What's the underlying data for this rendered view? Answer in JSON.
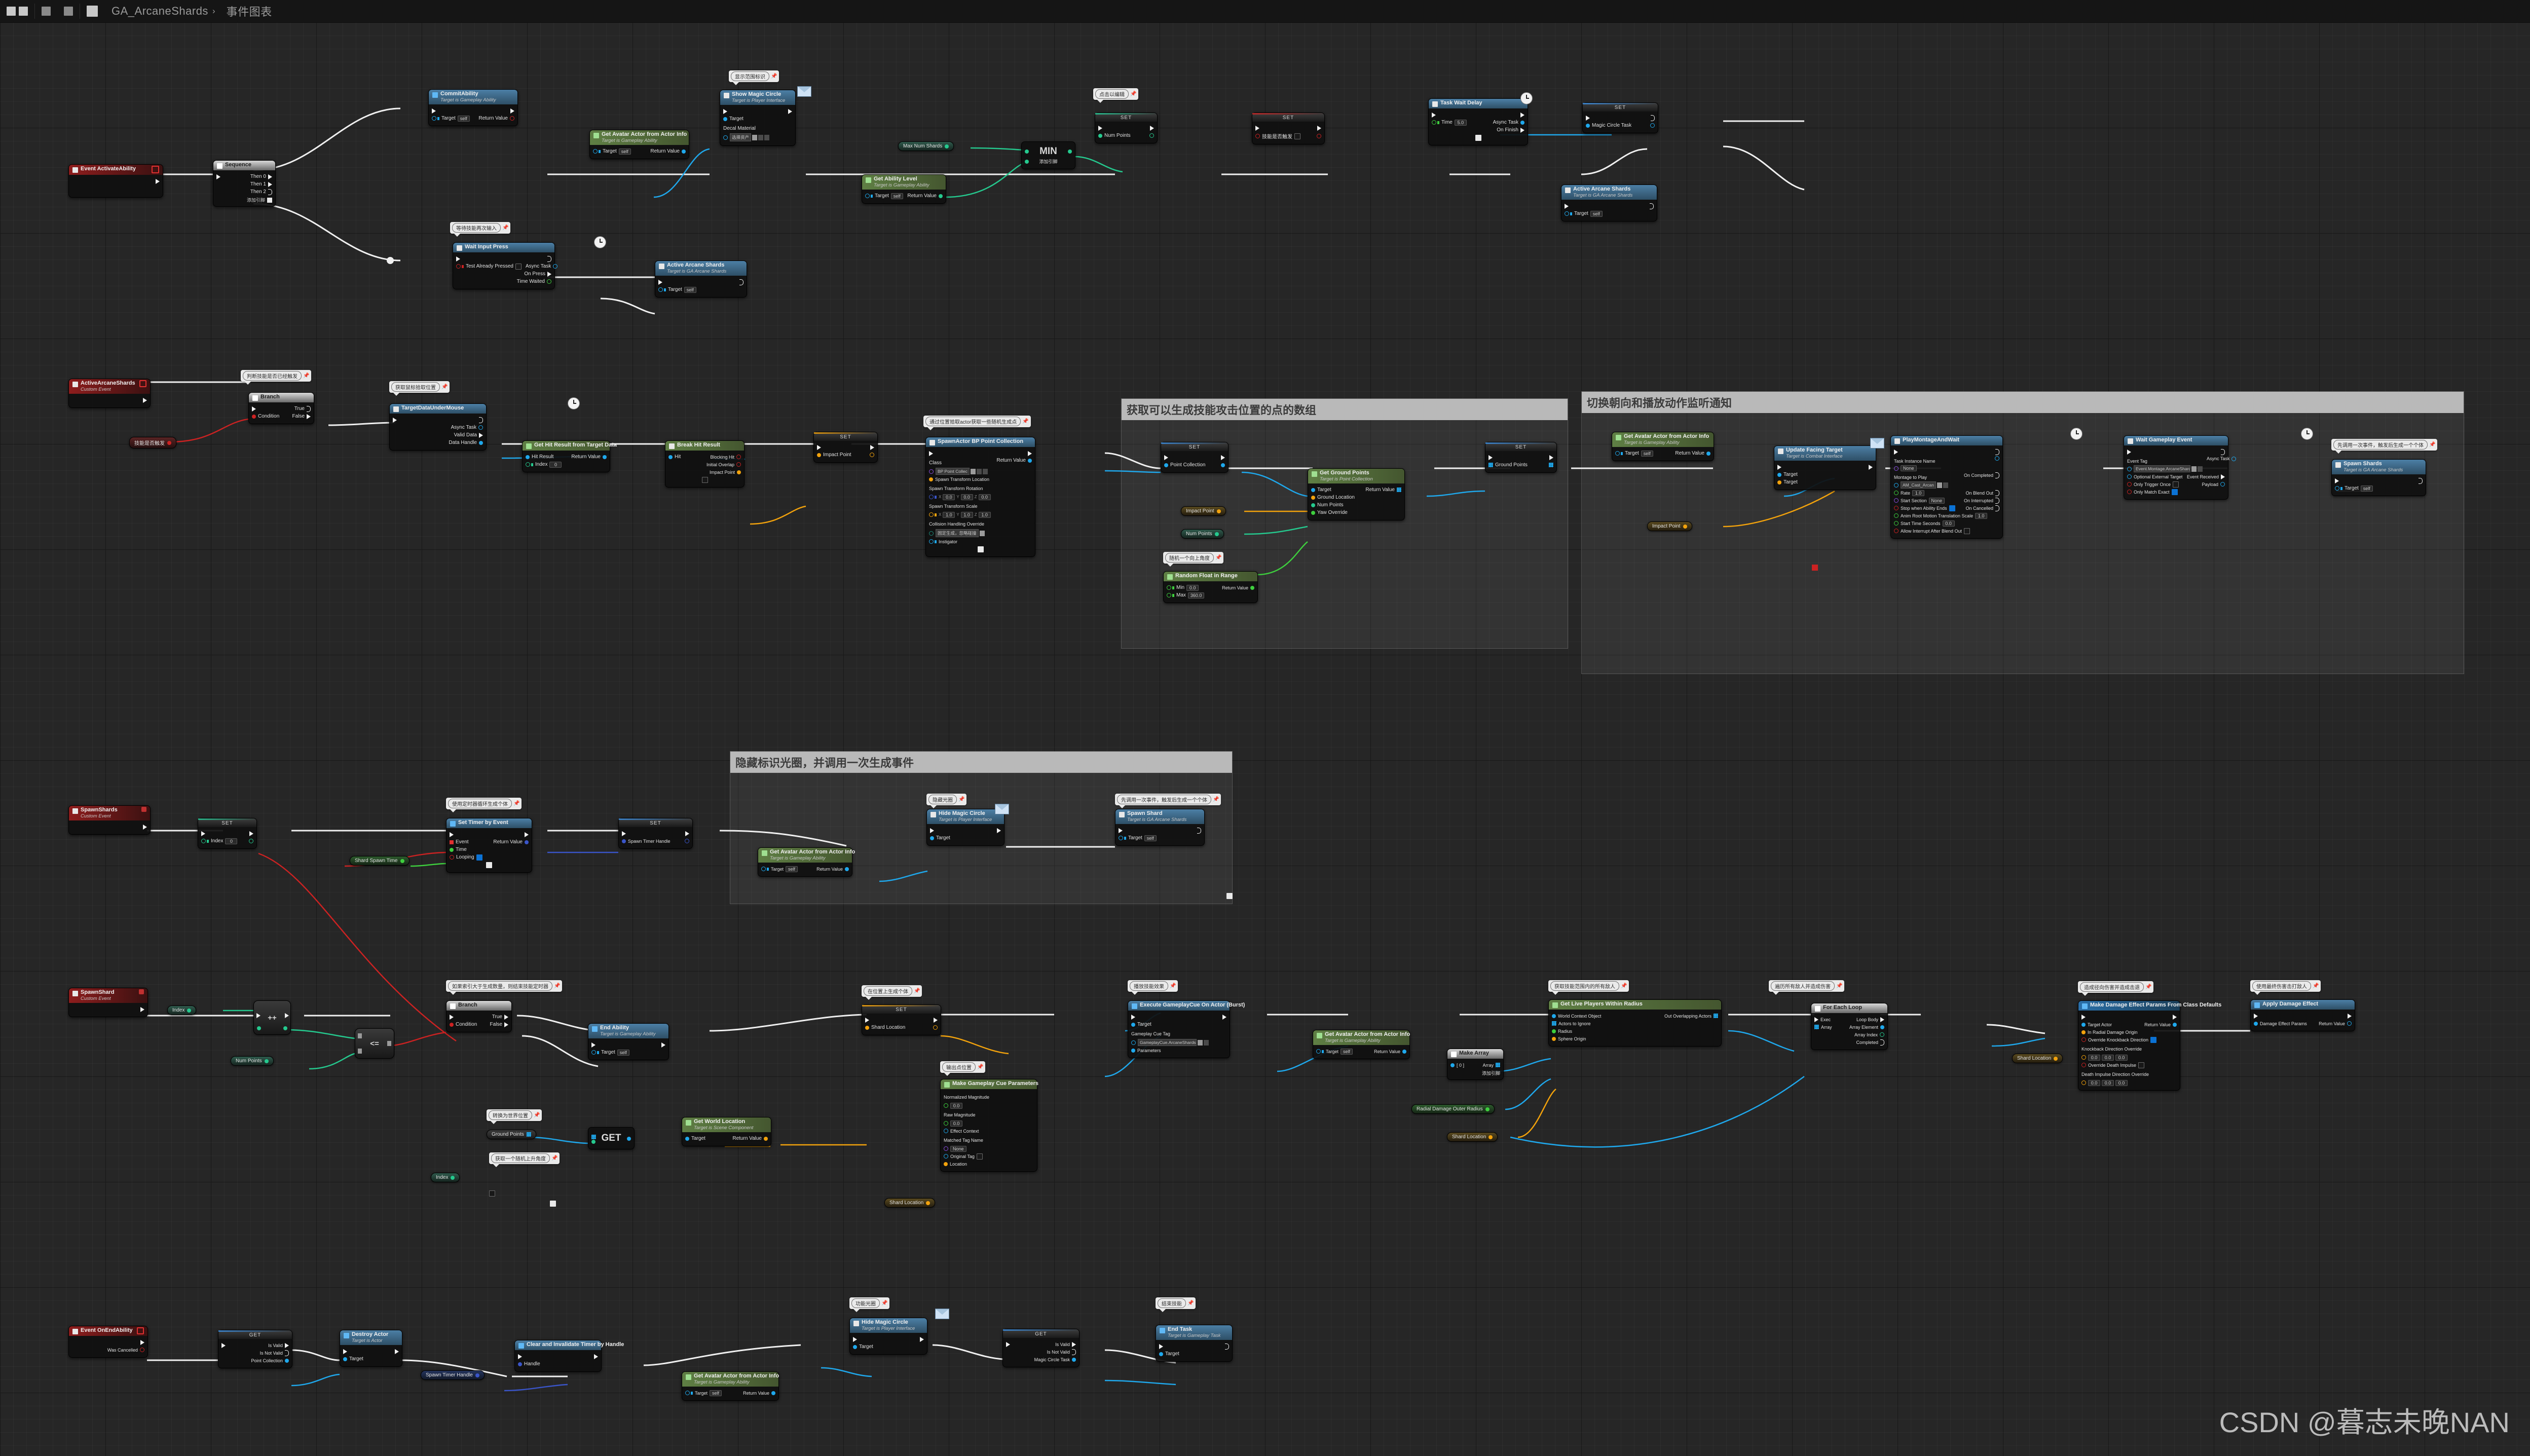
{
  "topbar": {
    "asset_name": "GA_ArcaneShards",
    "chevron": "›",
    "tab_name": "事件图表",
    "right_hint": ""
  },
  "watermark": "CSDN @暮志未晚NAN",
  "labels": {
    "target": "Target",
    "self": "self",
    "return_value": "Return Value",
    "add_pin": "添加引脚",
    "set": "SET",
    "get": "GET",
    "select_asset": "选择资产",
    "none": "None",
    "index": "Index"
  },
  "regions": [
    {
      "title": "获取可以生成技能攻击位置的点的数组"
    },
    {
      "title": "切换朝向和播放动作监听通知"
    },
    {
      "title": "隐藏标识光圈，并调用一次生成事件"
    }
  ],
  "bubbles": [
    {
      "text": "显示范围标识"
    },
    {
      "text": "等待技能再次输入"
    },
    {
      "text": "点击以编辑"
    },
    {
      "text": "判断技能是否已经触发"
    },
    {
      "text": "获取鼠标拾取位置"
    },
    {
      "text": "通过位置拾取actor获取一些随机生成点"
    },
    {
      "text": "随机一个向上角度"
    },
    {
      "text": "使用定时器循环生成个体"
    },
    {
      "text": "隐藏光圈"
    },
    {
      "text": "先调用一次事件，触发后生成一个个体"
    },
    {
      "text": "如果索引大于生成数量，则结束技能定时器"
    },
    {
      "text": "转换为世界位置"
    },
    {
      "text": "在位置上生成个体"
    },
    {
      "text": "获取一个随机上升角度"
    },
    {
      "text": "输出点位置"
    },
    {
      "text": "播放技能效果"
    },
    {
      "text": "获取技能范围内的所有敌人"
    },
    {
      "text": "遍历所有敌人并造成伤害"
    },
    {
      "text": "造成径向伤害并造成击退"
    },
    {
      "text": "使用最终伤害击打敌人"
    },
    {
      "text": "功能光圈"
    },
    {
      "text": "结束技能"
    }
  ],
  "nodes": {
    "event_activate_ability": {
      "title": "Event ActivateAbility"
    },
    "sequence": {
      "title": "Sequence",
      "then0": "Then 0",
      "then1": "Then 1",
      "then2": "Then 2"
    },
    "commit_ability": {
      "title": "CommitAbility",
      "sub": "Target is Gameplay Ability"
    },
    "get_avatar_actor": {
      "title": "Get Avatar Actor from Actor Info",
      "sub": "Target is Gameplay Ability"
    },
    "show_magic_circle": {
      "title": "Show Magic Circle",
      "sub": "Target is Player Interface",
      "decal": "Decal Material"
    },
    "get_ability_level": {
      "title": "Get Ability Level",
      "sub": "Target is Gameplay Ability"
    },
    "max_num_shards": {
      "title": "Max Num Shards"
    },
    "min_node": {
      "title": "MIN"
    },
    "set_num_points": {
      "title": "SET",
      "pin": "Num Points"
    },
    "set_skill_triggered": {
      "title": "SET",
      "pin": "技能是否触发"
    },
    "task_wait_delay": {
      "title": "Task Wait Delay",
      "time_label": "Time",
      "time_value": "5.0",
      "async": "Async Task",
      "on_finish": "On Finish"
    },
    "set_magic_circle_task": {
      "title": "SET",
      "pin": "Magic Circle Task"
    },
    "active_arcane_shards_call": {
      "title": "Active Arcane Shards",
      "sub": "Target is GA Arcane Shards"
    },
    "wait_input_press": {
      "title": "Wait Input Press",
      "test_pressed": "Test Already Pressed",
      "async": "Async Task",
      "on_press": "On Press",
      "time_waited": "Time Waited"
    },
    "event_active_arcane_shards": {
      "title": "ActiveArcaneShards",
      "sub": "Custom Event"
    },
    "var_skill_triggered": {
      "title": "技能是否触发"
    },
    "branch1": {
      "title": "Branch",
      "condition": "Condition",
      "t": "True",
      "f": "False"
    },
    "target_data_under_mouse": {
      "title": "TargetDataUnderMouse",
      "async": "Async Task",
      "valid": "Valid Data",
      "handle": "Data Handle"
    },
    "get_hit_result": {
      "title": "Get Hit Result from Target Data",
      "hit_result": "Hit Result",
      "index_value": "0"
    },
    "break_hit_result": {
      "title": "Break Hit Result",
      "hit": "Hit",
      "blocking": "Blocking Hit",
      "initial_overlap": "Initial Overlap",
      "impact_point": "Impact Point"
    },
    "set_impact_point": {
      "title": "SET",
      "pin": "Impact Point"
    },
    "spawn_actor_bppc": {
      "title": "SpawnActor BP Point Collection",
      "class_label": "Class",
      "class_value": "BP Point Collec",
      "loc_label": "Spawn Transform Location",
      "rot_label": "Spawn Transform Rotation",
      "rot": [
        "0.0",
        "0.0",
        "0.0"
      ],
      "scale_label": "Spawn Transform Scale",
      "scale": [
        "1.0",
        "1.0",
        "1.0"
      ],
      "collision_label": "Collision Handling Override",
      "collision_value": "固定生成，忽略碰撞",
      "instigator": "Instigator"
    },
    "set_point_collection": {
      "title": "SET",
      "pin": "Point Collection"
    },
    "get_ground_points": {
      "title": "Get Ground Points",
      "sub": "Target is Point Collection",
      "ground_location": "Ground Location",
      "num_points": "Num Points",
      "yaw_override": "Yaw Override"
    },
    "random_float_in_range": {
      "title": "Random Float in Range",
      "min_label": "Min",
      "min_value": "0.0",
      "max_label": "Max",
      "max_value": "360.0"
    },
    "var_impact_point": {
      "title": "Impact Point"
    },
    "var_num_points": {
      "title": "Num Points"
    },
    "set_ground_points": {
      "title": "SET",
      "pin": "Ground Points"
    },
    "update_facing_target": {
      "title": "Update Facing Target",
      "sub": "Target is Combat Interface",
      "t1": "Target",
      "t2": "Target"
    },
    "play_montage_and_wait": {
      "title": "PlayMontageAndWait",
      "task_instance_name": "Task Instance Name",
      "task_instance_value": "None",
      "montage_label": "Montage to Play",
      "montage_value": "AM_Cast_Arcan",
      "rate_label": "Rate",
      "rate_value": "1.0",
      "start_section": "Start Section",
      "start_section_value": "None",
      "stop_when_ends": "Stop when Ability Ends",
      "anim_root": "Anim Root Motion Translation Scale",
      "anim_root_value": "1.0",
      "start_time": "Start Time Seconds",
      "start_time_value": "0.0",
      "allow_interrupt": "Allow Interrupt After Blend Out",
      "on_completed": "On Completed",
      "on_blend_out": "On Blend Out",
      "on_interrupted": "On Interrupted",
      "on_cancelled": "On Cancelled"
    },
    "wait_gameplay_event": {
      "title": "Wait Gameplay Event",
      "event_tag_label": "Event Tag",
      "event_tag_value": "Event.Montage.ArcaneShards",
      "optional_target": "Optional External Target",
      "only_trigger_once": "Only Trigger Once",
      "only_match_exact": "Only Match Exact",
      "async": "Async Task",
      "event_received": "Event Received",
      "payload": "Payload"
    },
    "spawn_shards_call": {
      "title": "Spawn Shards",
      "sub": "Target is GA Arcane Shards"
    },
    "event_spawn_shards": {
      "title": "SpawnShards",
      "sub": "Custom Event"
    },
    "set_index": {
      "title": "SET",
      "pin": "Index",
      "value": "0"
    },
    "var_shard_spawn_time": {
      "title": "Shard Spawn Time"
    },
    "set_timer_by_event": {
      "title": "Set Timer by Event",
      "event": "Event",
      "time": "Time",
      "looping": "Looping"
    },
    "set_spawn_timer_handle": {
      "title": "SET",
      "pin": "Spawn Timer Handle"
    },
    "hide_magic_circle": {
      "title": "Hide Magic Circle",
      "sub": "Target is Player Interface"
    },
    "spawn_shard_call": {
      "title": "Spawn Shard",
      "sub": "Target is GA Arcane Shards"
    },
    "event_spawn_shard": {
      "title": "SpawnShard",
      "sub": "Custom Event"
    },
    "increment": {
      "title": "++"
    },
    "lte": {
      "title": "<="
    },
    "var_index": {
      "title": "Index"
    },
    "branch2": {
      "title": "Branch",
      "condition": "Condition",
      "t": "True",
      "f": "False"
    },
    "end_ability": {
      "title": "End Ability",
      "sub": "Target is Gameplay Ability"
    },
    "get_world_location": {
      "title": "Get World Location",
      "sub": "Target is Scene Component"
    },
    "var_ground_points": {
      "title": "Ground Points"
    },
    "get_array_item": {
      "title": "GET"
    },
    "set_shard_location": {
      "title": "SET",
      "pin": "Shard Location"
    },
    "make_gameplay_cue_params": {
      "title": "Make Gameplay Cue Parameters",
      "normalized_magnitude": "Normalized Magnitude",
      "normalized_value": "0.0",
      "raw_magnitude": "Raw Magnitude",
      "raw_value": "0.0",
      "effect_context": "Effect Context",
      "matched_tag": "Matched Tag Name",
      "matched_value": "None",
      "original_tag": "Original Tag",
      "location": "Location"
    },
    "var_shard_location": {
      "title": "Shard Location"
    },
    "execute_gameplay_cue": {
      "title": "Execute GameplayCue On Actor (Burst)",
      "cue_tag_label": "Gameplay Cue Tag",
      "cue_tag_value": "GameplayCue.ArcaneShards",
      "parameters": "Parameters"
    },
    "sphere_overlap": {
      "title": "Get Live Players Within Radius",
      "world_context": "World Context Object",
      "actors_to_ignore": "Actors to Ignore",
      "radius": "Radius",
      "sphere_origin": "Sphere Origin",
      "out_overlapping": "Out Overlapping Actors"
    },
    "make_array": {
      "title": "Make Array",
      "item0": "[ 0 ]",
      "array": "Array"
    },
    "var_radial_radius": {
      "title": "Radial Damage Outer Radius"
    },
    "for_each_loop": {
      "title": "For Each Loop",
      "exec": "Exec",
      "array": "Array",
      "loop_body": "Loop Body",
      "array_element": "Array Element",
      "array_index": "Array Index",
      "completed": "Completed"
    },
    "make_damage_effect_params": {
      "title": "Make Damage Effect Params From Class Defaults",
      "target_actor": "Target Actor",
      "radial_origin": "In Radial Damage Origin",
      "override_knockback": "Override Knockback Direction",
      "knockback_dir": "Knockback Direction Override",
      "override_death": "Override Death Impulse",
      "death_impulse_dir": "Death Impulse Direction Override"
    },
    "apply_damage_effect": {
      "title": "Apply Damage Effect",
      "params": "Damage Effect Params"
    },
    "event_on_end_ability": {
      "title": "Event OnEndAbility",
      "was_cancelled": "Was Cancelled"
    },
    "get_valid": {
      "title": "GET",
      "is_valid": "Is Valid",
      "is_not_valid": "Is Not Valid",
      "point_collection": "Point Collection"
    },
    "destroy_actor": {
      "title": "Destroy Actor",
      "sub": "Target is Actor"
    },
    "var_spawn_timer_handle": {
      "title": "Spawn Timer Handle"
    },
    "clear_timer": {
      "title": "Clear and Invalidate Timer by Handle",
      "handle": "Handle"
    },
    "hide_magic_circle2": {
      "title": "Hide Magic Circle",
      "sub": "Target is Player Interface"
    },
    "get_valid2": {
      "title": "GET",
      "is_valid": "Is Valid",
      "is_not_valid": "Is Not Valid",
      "magic_circle_task": "Magic Circle Task"
    },
    "end_task": {
      "title": "End Task",
      "sub": "Target is Gameplay Task"
    },
    "get_avatar_end": {
      "title": "Get Avatar Actor from Actor Info",
      "sub": "Target is Gameplay Ability"
    }
  }
}
